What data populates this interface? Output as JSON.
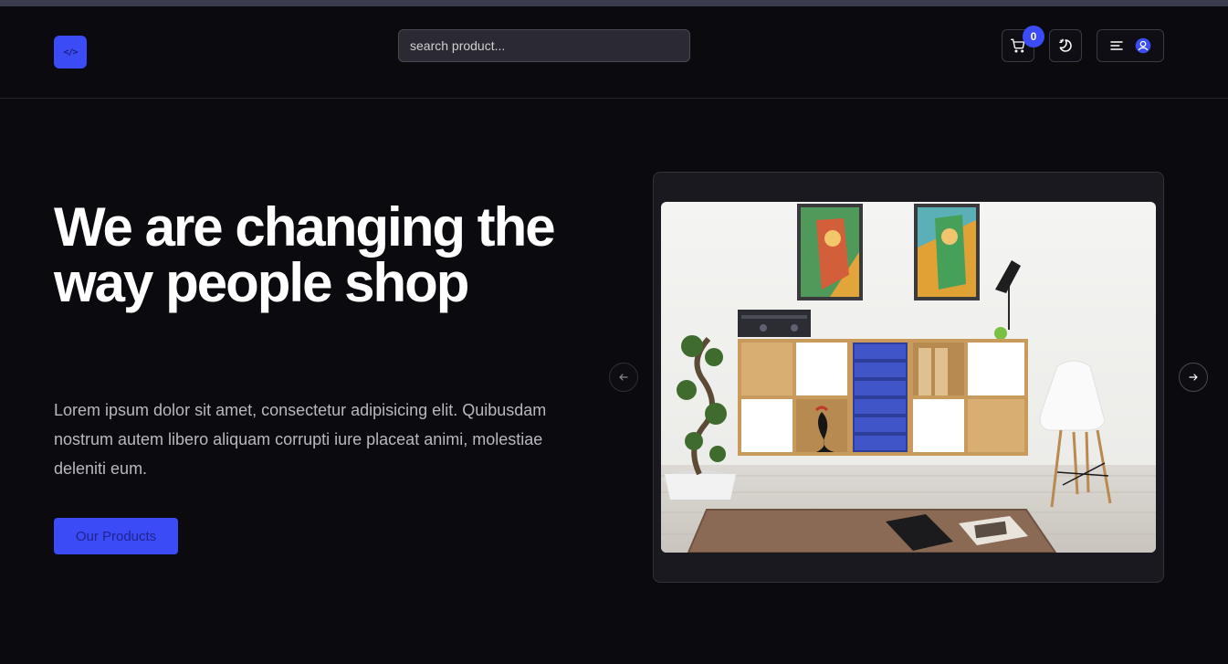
{
  "header": {
    "logo_text": "</>",
    "search_placeholder": "search product...",
    "cart_count": "0"
  },
  "hero": {
    "title": "We are changing the way people shop",
    "description": "Lorem ipsum dolor sit amet, consectetur adipisicing elit. Quibusdam nostrum autem libero aliquam corrupti iure placeat animi, molestiae deleniti eum.",
    "cta_label": "Our Products"
  },
  "colors": {
    "accent": "#3b4cf6",
    "background": "#0b0a0f",
    "card": "#1a1920"
  },
  "icons": [
    "code-icon",
    "cart-icon",
    "theme-toggle-icon",
    "menu-icon",
    "user-icon",
    "arrow-left-icon",
    "arrow-right-icon"
  ]
}
